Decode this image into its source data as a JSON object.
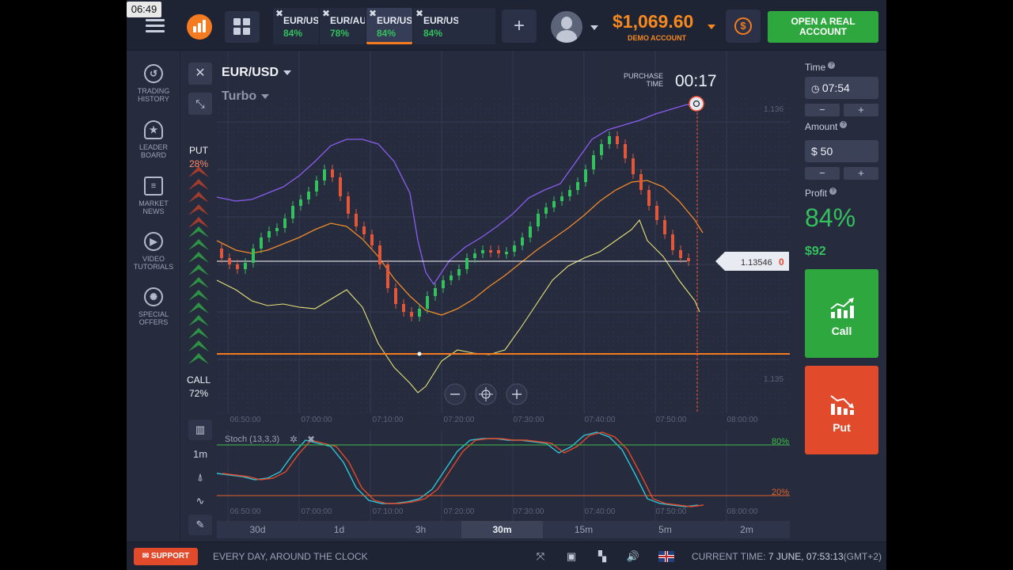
{
  "status": {
    "clock": "06:49"
  },
  "header": {
    "tabs": [
      {
        "name": "EUR/USD",
        "pct": "84%",
        "active": false
      },
      {
        "name": "EUR/AUD",
        "pct": "78%",
        "active": false
      },
      {
        "name": "EUR/USD",
        "pct": "84%",
        "active": true
      },
      {
        "name": "EUR/USD",
        "pct": "84%",
        "active": false
      }
    ],
    "add_tab": "+",
    "balance": "$1,069.60",
    "account_type": "DEMO ACCOUNT",
    "real_account_line1": "OPEN A REAL",
    "real_account_line2": "ACCOUNT"
  },
  "sidebar": {
    "items": [
      {
        "label1": "TRADING",
        "label2": "HISTORY",
        "icon": "history-icon"
      },
      {
        "label1": "LEADER",
        "label2": "BOARD",
        "icon": "leaderboard-icon"
      },
      {
        "label1": "MARKET",
        "label2": "NEWS",
        "icon": "news-icon"
      },
      {
        "label1": "VIDEO",
        "label2": "TUTORIALS",
        "icon": "play-icon"
      },
      {
        "label1": "SPECIAL",
        "label2": "OFFERS",
        "icon": "offers-icon"
      }
    ]
  },
  "chart": {
    "asset": "EUR/USD",
    "mode": "Turbo",
    "purchase_label1": "PURCHASE",
    "purchase_label2": "TIME",
    "purchase_time": "00:17",
    "put_label": "PUT",
    "put_pct": "28%",
    "call_label": "CALL",
    "call_pct": "72%",
    "price_tag": "1.13546",
    "price_tag_digit": "0",
    "y_top": "1.136",
    "y_bottom": "1.135",
    "x_labels": [
      "06:50:00",
      "07:00:00",
      "07:10:00",
      "07:20:00",
      "07:30:00",
      "07:40:00",
      "07:50:00",
      "08:00:00"
    ],
    "indicator": "Stoch (13,3,3)",
    "level_high": "80%",
    "level_low": "20%",
    "timeframe": "1m",
    "periods": [
      "30d",
      "1d",
      "3h",
      "30m",
      "15m",
      "5m",
      "2m"
    ],
    "active_period": "30m"
  },
  "panel": {
    "time_label": "Time",
    "time_value": "07:54",
    "amount_label": "Amount",
    "amount_value": "$  50",
    "profit_label": "Profit",
    "profit_pct": "84%",
    "profit_amount": "$92",
    "call": "Call",
    "put": "Put",
    "minus": "−",
    "plus": "+"
  },
  "footer": {
    "support": "SUPPORT",
    "slogan": "EVERY DAY, AROUND THE CLOCK",
    "current_time_label": "CURRENT TIME:",
    "current_time_value": "7 JUNE, 07:53:13",
    "tz": "(GMT+2)"
  },
  "colors": {
    "accent": "#f47b20",
    "call": "#2ea83e",
    "put": "#e14a2b",
    "up": "#33c15d",
    "down": "#e2563a"
  }
}
